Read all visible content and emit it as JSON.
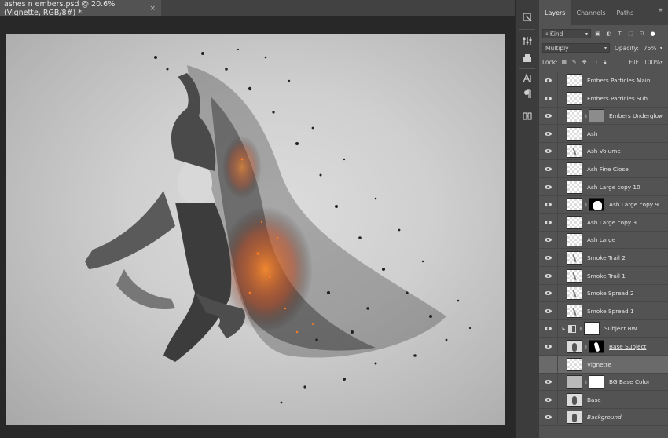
{
  "document": {
    "tab_title": "ashes n embers.psd @ 20.6% (Vignette, RGB/8#) *",
    "close_glyph": "×"
  },
  "panel": {
    "tabs": [
      {
        "label": "Layers",
        "active": true
      },
      {
        "label": "Channels",
        "active": false
      },
      {
        "label": "Paths",
        "active": false
      }
    ],
    "filter": {
      "kind_label": "Kind",
      "kind_icon": "search-icon"
    },
    "blend_mode": "Multiply",
    "opacity_label": "Opacity:",
    "opacity_value": "75%",
    "lock_label": "Lock:",
    "fill_label": "Fill:",
    "fill_value": "100%"
  },
  "layers": [
    {
      "name": "Embers Particles Main",
      "thumb": "checker",
      "mask": null,
      "visible": true
    },
    {
      "name": "Embers Particles Sub",
      "thumb": "checker",
      "mask": null,
      "visible": true
    },
    {
      "name": "Embers Underglow",
      "thumb": "checker",
      "mask": "noise",
      "visible": true
    },
    {
      "name": "Ash",
      "thumb": "checker",
      "mask": null,
      "visible": true
    },
    {
      "name": "Ash Volume",
      "thumb": "figure",
      "mask": null,
      "visible": true
    },
    {
      "name": "Ash Fine Close",
      "thumb": "checker",
      "mask": null,
      "visible": true
    },
    {
      "name": "Ash Large copy 10",
      "thumb": "checker",
      "mask": null,
      "visible": true
    },
    {
      "name": "Ash Large copy 9",
      "thumb": "checker",
      "mask": "black",
      "visible": true
    },
    {
      "name": "Ash Large copy 3",
      "thumb": "checker",
      "mask": null,
      "visible": true
    },
    {
      "name": "Ash Large",
      "thumb": "checker",
      "mask": null,
      "visible": true
    },
    {
      "name": "Smoke Trail 2",
      "thumb": "figure",
      "mask": null,
      "visible": true
    },
    {
      "name": "Smoke Trail 1",
      "thumb": "figure",
      "mask": null,
      "visible": true
    },
    {
      "name": "Smoke Spread 2",
      "thumb": "figure",
      "mask": null,
      "visible": true
    },
    {
      "name": "Smoke Spread 1",
      "thumb": "figure",
      "mask": null,
      "visible": true
    },
    {
      "name": "Subject BW",
      "thumb": "adjustment",
      "mask": "white",
      "visible": true,
      "clipped": true
    },
    {
      "name": "Base Subject",
      "thumb": "subject",
      "mask": "subject",
      "visible": true,
      "style": "underline"
    },
    {
      "name": "Vignette",
      "thumb": "checker",
      "mask": null,
      "visible": false,
      "selected": true
    },
    {
      "name": "BG Base Color",
      "thumb": "gray",
      "mask": "white",
      "visible": true
    },
    {
      "name": "Base",
      "thumb": "subject",
      "mask": null,
      "visible": true
    },
    {
      "name": "Background",
      "thumb": "subject",
      "mask": null,
      "visible": true,
      "style": "italic"
    }
  ],
  "tools": [
    "history-icon",
    "adjust-icon",
    "character-icon",
    "paragraph-icon",
    "properties-icon"
  ]
}
